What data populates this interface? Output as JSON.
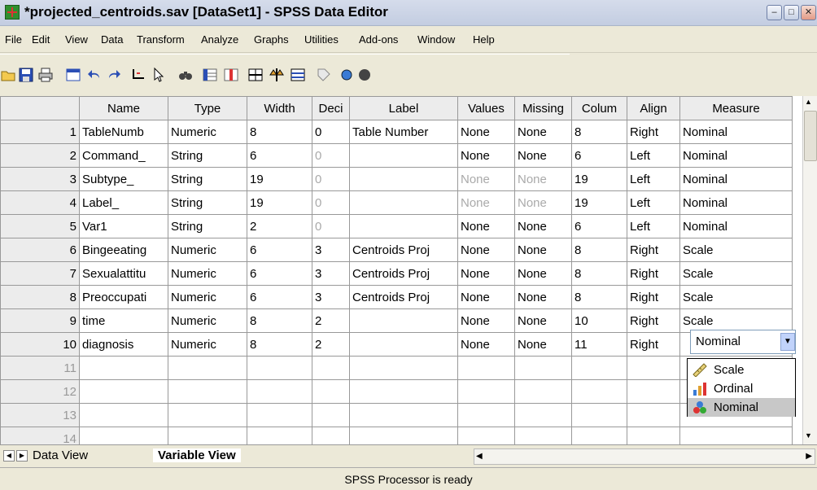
{
  "window": {
    "title": "*projected_centroids.sav [DataSet1] - SPSS Data Editor",
    "minimize": "‒",
    "maximize": "□",
    "close": "✕"
  },
  "menu": [
    "File",
    "Edit",
    "View",
    "Data",
    "Transform",
    "Analyze",
    "Graphs",
    "Utilities",
    "Add-ons",
    "Window",
    "Help"
  ],
  "toolbar_icons": [
    "open-icon",
    "save-icon",
    "print-icon",
    "dialog-recall-icon",
    "undo-icon",
    "redo-icon",
    "goto-case-icon",
    "variables-icon",
    "find-icon",
    "insert-cases-icon",
    "insert-variable-icon",
    "split-file-icon",
    "weight-cases-icon",
    "select-cases-icon",
    "value-labels-icon",
    "use-sets-icon"
  ],
  "grid": {
    "headers": [
      "",
      "Name",
      "Type",
      "Width",
      "Deci",
      "Label",
      "Values",
      "Missing",
      "Colum",
      "Align",
      "Measure"
    ],
    "rows": [
      {
        "n": "1",
        "name": "TableNumb",
        "type": "Numeric",
        "width": "8",
        "dec": "0",
        "label": "Table Number",
        "values": "None",
        "missing": "None",
        "columns": "8",
        "align": "Right",
        "measure": "Nominal"
      },
      {
        "n": "2",
        "name": "Command_",
        "type": "String",
        "width": "6",
        "dec": "0",
        "label": "",
        "values": "None",
        "missing": "None",
        "columns": "6",
        "align": "Left",
        "measure": "Nominal"
      },
      {
        "n": "3",
        "name": "Subtype_",
        "type": "String",
        "width": "19",
        "dec": "0",
        "label": "",
        "values": "None",
        "missing": "None",
        "columns": "19",
        "align": "Left",
        "measure": "Nominal"
      },
      {
        "n": "4",
        "name": "Label_",
        "type": "String",
        "width": "19",
        "dec": "0",
        "label": "",
        "values": "None",
        "missing": "None",
        "columns": "19",
        "align": "Left",
        "measure": "Nominal"
      },
      {
        "n": "5",
        "name": "Var1",
        "type": "String",
        "width": "2",
        "dec": "0",
        "label": "",
        "values": "None",
        "missing": "None",
        "columns": "6",
        "align": "Left",
        "measure": "Nominal"
      },
      {
        "n": "6",
        "name": "Bingeeating",
        "type": "Numeric",
        "width": "6",
        "dec": "3",
        "label": "Centroids Proj",
        "values": "None",
        "missing": "None",
        "columns": "8",
        "align": "Right",
        "measure": "Scale"
      },
      {
        "n": "7",
        "name": "Sexualattitu",
        "type": "Numeric",
        "width": "6",
        "dec": "3",
        "label": "Centroids Proj",
        "values": "None",
        "missing": "None",
        "columns": "8",
        "align": "Right",
        "measure": "Scale"
      },
      {
        "n": "8",
        "name": "Preoccupati",
        "type": "Numeric",
        "width": "6",
        "dec": "3",
        "label": "Centroids Proj",
        "values": "None",
        "missing": "None",
        "columns": "8",
        "align": "Right",
        "measure": "Scale"
      },
      {
        "n": "9",
        "name": "time",
        "type": "Numeric",
        "width": "8",
        "dec": "2",
        "label": "",
        "values": "None",
        "missing": "None",
        "columns": "10",
        "align": "Right",
        "measure": "Scale"
      },
      {
        "n": "10",
        "name": "diagnosis",
        "type": "Numeric",
        "width": "8",
        "dec": "2",
        "label": "",
        "values": "None",
        "missing": "None",
        "columns": "11",
        "align": "Right",
        "measure": ""
      }
    ],
    "empty_rows": [
      "11",
      "12",
      "13",
      "14"
    ]
  },
  "measure_dropdown": {
    "value": "Nominal",
    "options": [
      {
        "label": "Scale",
        "icon": "scale-ruler-icon"
      },
      {
        "label": "Ordinal",
        "icon": "ordinal-bars-icon"
      },
      {
        "label": "Nominal",
        "icon": "nominal-circles-icon",
        "selected": true
      }
    ]
  },
  "tabs": {
    "data_view": "Data View",
    "variable_view": "Variable View"
  },
  "status": "SPSS Processor is ready"
}
